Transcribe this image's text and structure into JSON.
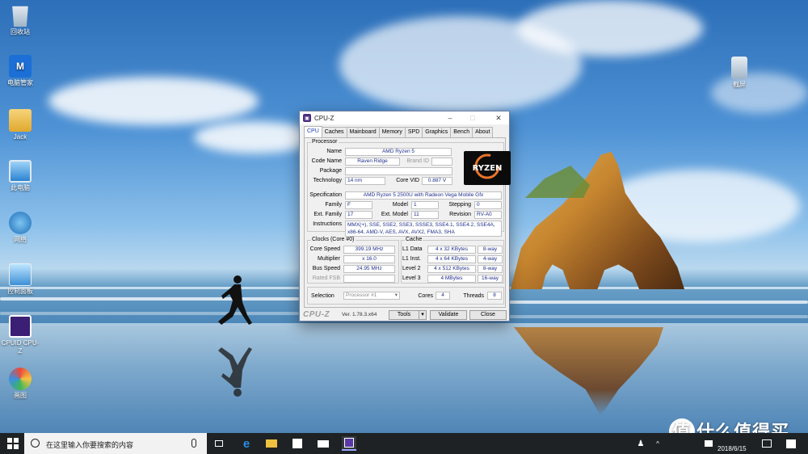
{
  "desktop": {
    "icons": [
      {
        "label": "回收站",
        "icon": "recycle-bin-icon"
      },
      {
        "label": "电脑管家",
        "icon": "pc-manager-icon"
      },
      {
        "label": "Jack",
        "icon": "user-folder-icon"
      },
      {
        "label": "此电脑",
        "icon": "this-pc-icon"
      },
      {
        "label": "网络",
        "icon": "network-icon"
      },
      {
        "label": "控制面板",
        "icon": "control-panel-icon"
      },
      {
        "label": "CPUID CPU-Z",
        "icon": "cpuz-icon"
      },
      {
        "label": "画图",
        "icon": "paint-icon"
      },
      {
        "label": "截屏",
        "icon": "screenshot-icon"
      }
    ]
  },
  "cpuz": {
    "title": "CPU-Z",
    "tabs": [
      "CPU",
      "Caches",
      "Mainboard",
      "Memory",
      "SPD",
      "Graphics",
      "Bench",
      "About"
    ],
    "active_tab": "CPU",
    "processor": {
      "group_title": "Processor",
      "name_label": "Name",
      "name": "AMD Ryzen 5",
      "codename_label": "Code Name",
      "codename": "Raven Ridge",
      "brandid_label": "Brand ID",
      "brandid": "",
      "package_label": "Package",
      "package": "",
      "technology_label": "Technology",
      "technology": "14 nm",
      "corevid_label": "Core VID",
      "corevid": "0.887 V",
      "spec_label": "Specification",
      "spec": "AMD Ryzen 5 2500U with Radeon Vega Mobile Gfx",
      "family_label": "Family",
      "family": "F",
      "model_label": "Model",
      "model": "1",
      "stepping_label": "Stepping",
      "stepping": "0",
      "extfamily_label": "Ext. Family",
      "extfamily": "17",
      "extmodel_label": "Ext. Model",
      "extmodel": "11",
      "revision_label": "Revision",
      "revision": "RV-A0",
      "instructions_label": "Instructions",
      "instructions_line1": "MMX(+), SSE, SSE2, SSE3, SSSE3, SSE4.1, SSE4.2, SSE4A,",
      "instructions_line2": "x86-64, AMD-V, AES, AVX, AVX2, FMA3, SHA",
      "logo_text": "RYZEN"
    },
    "clocks": {
      "group_title": "Clocks (Core #0)",
      "corespeed_label": "Core Speed",
      "corespeed": "399.19 MHz",
      "multiplier_label": "Multiplier",
      "multiplier": "x 16.0",
      "busspeed_label": "Bus Speed",
      "busspeed": "24.95 MHz",
      "ratedfsb_label": "Rated FSB",
      "ratedfsb": ""
    },
    "cache": {
      "group_title": "Cache",
      "rows": [
        {
          "label": "L1 Data",
          "size": "4 x 32 KBytes",
          "way": "8-way"
        },
        {
          "label": "L1 Inst.",
          "size": "4 x 64 KBytes",
          "way": "4-way"
        },
        {
          "label": "Level 2",
          "size": "4 x 512 KBytes",
          "way": "8-way"
        },
        {
          "label": "Level 3",
          "size": "4 MBytes",
          "way": "16-way"
        }
      ]
    },
    "selection_label": "Selection",
    "selection_value": "Processor #1",
    "cores_label": "Cores",
    "cores": "4",
    "threads_label": "Threads",
    "threads": "8",
    "brand": "CPU-Z",
    "version": "Ver. 1.78.3.x64",
    "tools_label": "Tools",
    "validate_label": "Validate",
    "close_label": "Close"
  },
  "taskbar": {
    "search_placeholder": "在这里输入你要搜索的内容",
    "date": "2018/6/15"
  },
  "watermark": "值 什么值得买"
}
